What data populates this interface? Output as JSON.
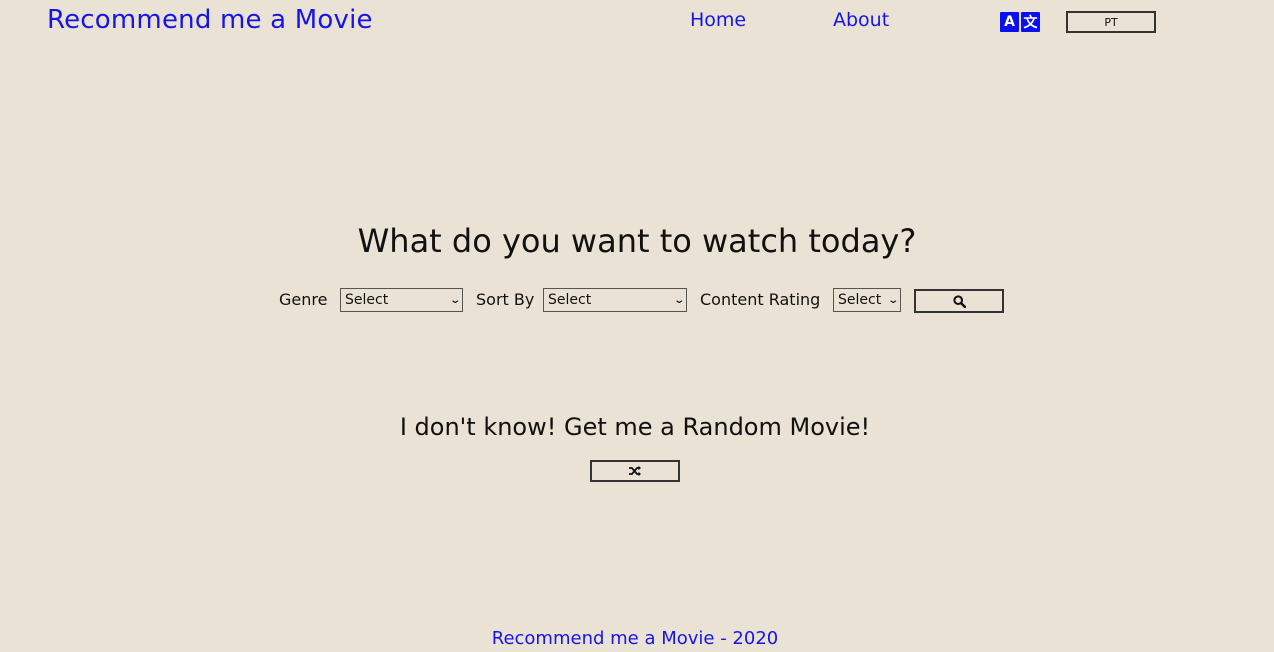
{
  "header": {
    "brand": "Recommend me a Movie",
    "nav": {
      "home": "Home",
      "about": "About"
    },
    "translate_icon": "translate-icon",
    "translate_glyphs": [
      "A",
      "文"
    ],
    "language_button": "PT"
  },
  "main": {
    "heading": "What do you want to watch today?",
    "filters": {
      "genre_label": "Genre",
      "genre_value": "Select",
      "sort_label": "Sort By",
      "sort_value": "Select",
      "rating_label": "Content Rating",
      "rating_value": "Select"
    },
    "search_icon": "search-icon",
    "random_heading": "I don't know! Get me a Random Movie!",
    "random_icon": "shuffle-icon"
  },
  "footer": {
    "text": "Recommend me a Movie - 2020"
  },
  "colors": {
    "background": "#eae3d5",
    "link": "#1515e6",
    "translate_icon": "#0b10f0"
  }
}
